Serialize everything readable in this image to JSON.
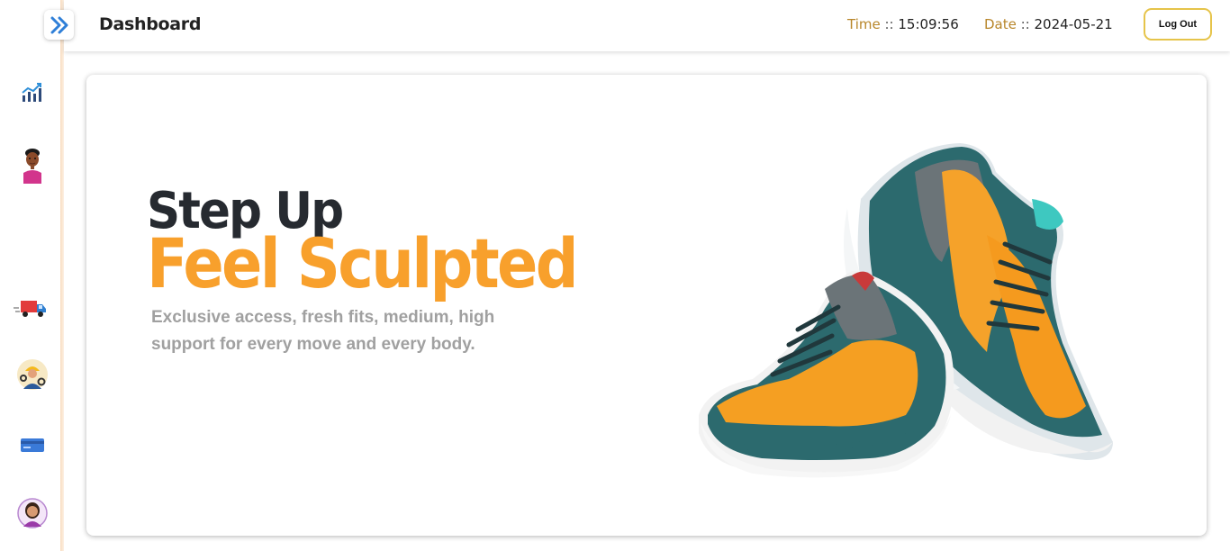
{
  "header": {
    "title": "Dashboard",
    "time_label": "Time",
    "time_sep": " :: ",
    "time_value": "15:09:56",
    "date_label": "Date",
    "date_sep": " :: ",
    "date_value": "2024-05-21",
    "logout_label": "Log Out"
  },
  "sidebar": {
    "items": [
      {
        "icon": "analytics-chart-icon"
      },
      {
        "icon": "user-avatar-icon"
      },
      {
        "icon": "delivery-truck-icon"
      },
      {
        "icon": "worker-settings-icon"
      },
      {
        "icon": "credit-card-icon"
      },
      {
        "icon": "profile-avatar-icon"
      }
    ]
  },
  "hero": {
    "line1": "Step Up",
    "line2": "Feel Sculpted",
    "description": "Exclusive access, fresh fits, medium, high support for every move and every body."
  },
  "colors": {
    "accent_orange": "#f8a02c",
    "header_label": "#b8862a",
    "logout_border": "#e6c44a",
    "sidebar_border": "#f8dcc0"
  }
}
